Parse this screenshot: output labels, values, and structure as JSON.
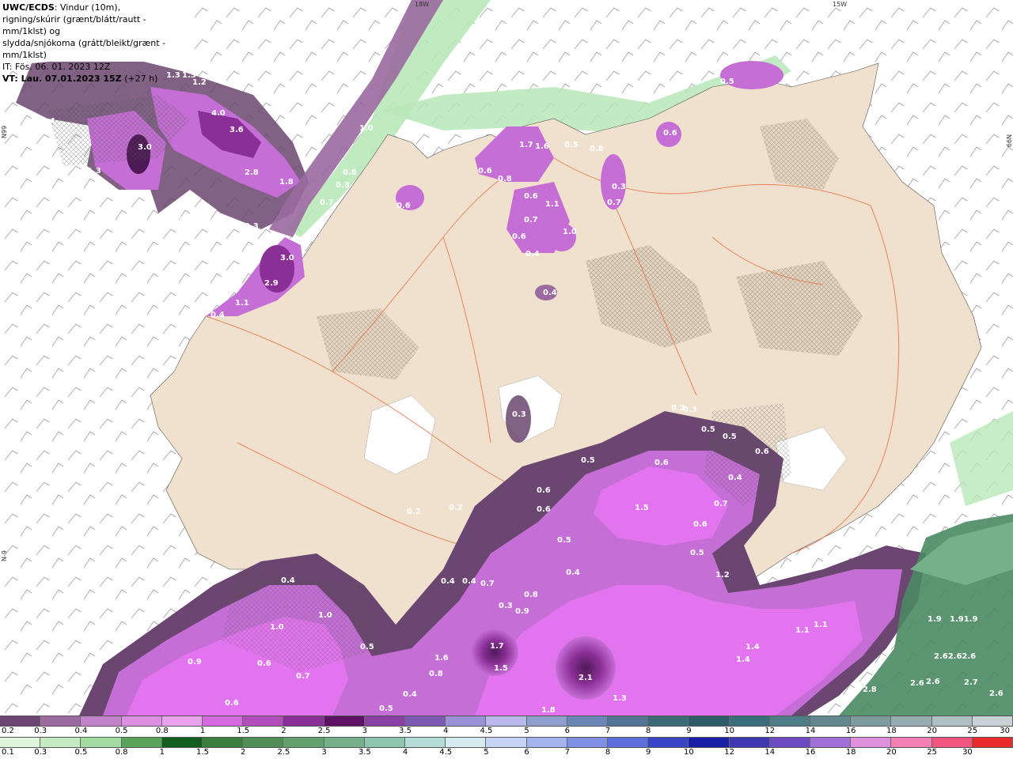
{
  "header": {
    "title_bold": "UWC/ECDS",
    "title_rest": ": Vindur (10m),",
    "line2": "rigning/skúrir (grænt/blátt/rautt - mm/1klst) og",
    "line3": "slydda/snjókoma (grátt/bleikt/grænt - mm/1klst)",
    "init_time": "IT: Fös. 06. 01. 2023 12Z",
    "valid_bold": "VT: Lau. 07.01.2023 15Z",
    "valid_rest": " (+27 h)"
  },
  "coords": {
    "lon_top_1": "18W",
    "lon_top_2": "15W",
    "lat_right": "N99",
    "lat_left_1": "N99",
    "lat_left_2": "N-9"
  },
  "colors": {
    "land": "#efe1cd",
    "sea": "#ffffff",
    "roads": "#e8764a",
    "snow_light": "#c56fd6",
    "snow_mid": "#e374ef",
    "snow_dark": "#7d3a8a",
    "snow_darkest": "#4d1a55",
    "rain_light": "#b9e8b9",
    "rain_dark": "#4a8a63",
    "hatch": "#444444"
  },
  "precip_labels": [
    "0.4",
    "1.3",
    "1.3",
    "1.2",
    "4.0",
    "3.6",
    "3.0",
    "1.3",
    "2.8",
    "1.8",
    "0.3",
    "0.5",
    "0.3",
    "3.0",
    "2.9",
    "1.1",
    "0.4",
    "1.0",
    "0.8",
    "0.3",
    "0.7",
    "0.6",
    "0.8",
    "1.7",
    "1.6",
    "0.5",
    "0.6",
    "0.8",
    "0.6",
    "1.1",
    "0.7",
    "0.6",
    "1.0",
    "0.4",
    "0.3",
    "0.7",
    "0.3",
    "0.6",
    "0.5",
    "0.2",
    "0.4",
    "0.3",
    "0.5",
    "0.5",
    "0.6",
    "0.6",
    "0.4",
    "0.6",
    "0.6",
    "0.7",
    "1.5",
    "0.6",
    "0.5",
    "0.2",
    "0.2",
    "0.5",
    "0.4",
    "0.4",
    "0.4",
    "0.7",
    "0.8",
    "0.3",
    "0.9",
    "0.5",
    "1.2",
    "0.4",
    "1.0",
    "1.0",
    "0.9",
    "0.6",
    "0.7",
    "0.6",
    "0.5",
    "1.6",
    "0.8",
    "1.7",
    "1.5",
    "2.1",
    "1.3",
    "1.8",
    "0.4",
    "0.5",
    "1.1",
    "1.1",
    "1.4",
    "1.4",
    "1.9",
    "1.91.9",
    "2.62.62.6",
    "2.6",
    "2.6",
    "2.7",
    "2.6",
    "2.8"
  ],
  "snow_scale": {
    "labels": [
      "0.2",
      "0.3",
      "0.4",
      "0.5",
      "0.8",
      "1",
      "1.5",
      "2",
      "2.5",
      "3",
      "3.5",
      "4",
      "4.5",
      "5",
      "6",
      "7",
      "8",
      "9",
      "10",
      "12",
      "14",
      "16",
      "18",
      "20",
      "25",
      "30"
    ],
    "colors": [
      "#6b4670",
      "#9a6aa0",
      "#c283c8",
      "#de8fe4",
      "#eaa2ef",
      "#d669df",
      "#b24dbb",
      "#8a2f96",
      "#5d1266",
      "#8a3fa5",
      "#7d5ab3",
      "#9a91d9",
      "#b9b8e9",
      "#8fa0cf",
      "#6c86b8",
      "#557496",
      "#3c6a76",
      "#2e5c68",
      "#3a6e7a",
      "#4d7d86",
      "#63898f",
      "#7e9ba0",
      "#97acb0",
      "#afc0c2",
      "#c9d3d5"
    ]
  },
  "rain_scale": {
    "labels": [
      "0.1",
      "0.3",
      "0.5",
      "0.8",
      "1",
      "1.5",
      "2",
      "2.5",
      "3",
      "3.5",
      "4",
      "4.5",
      "5",
      "6",
      "7",
      "8",
      "9",
      "10",
      "12",
      "14",
      "16",
      "18",
      "20",
      "25",
      "30"
    ],
    "colors": [
      "#dff5dc",
      "#c4ebc2",
      "#a3dba0",
      "#5aa35a",
      "#125e1e",
      "#3b7d3d",
      "#4f8e54",
      "#62a06e",
      "#74b18b",
      "#8ec5b0",
      "#b4ddd8",
      "#d5ebef",
      "#c6d3f4",
      "#a4b4ee",
      "#8090e4",
      "#5c6fdb",
      "#3a44c8",
      "#1a1fa8",
      "#3f38b2",
      "#6d4cc3",
      "#a06ed7",
      "#e08fdd",
      "#f37fb5",
      "#f15580",
      "#ea2b2b"
    ]
  }
}
